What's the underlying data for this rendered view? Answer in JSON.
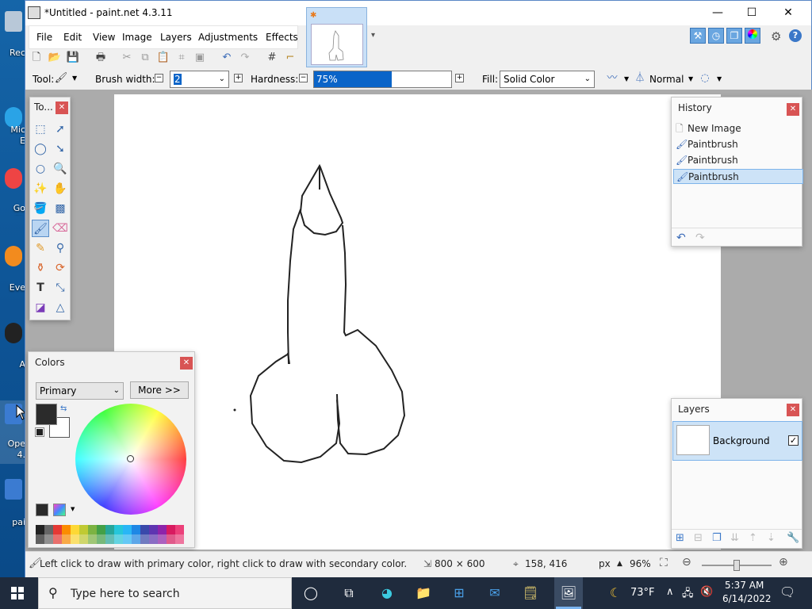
{
  "window": {
    "title": "*Untitled - paint.net 4.3.11",
    "minimize": "—",
    "maximize": "☐",
    "close": "✕"
  },
  "menu": [
    "File",
    "Edit",
    "View",
    "Image",
    "Layers",
    "Adjustments",
    "Effects"
  ],
  "toolbar": {
    "tool_label": "Tool:",
    "brush_width_label": "Brush width:",
    "brush_width_value": "2",
    "hardness_label": "Hardness:",
    "hardness_value": "75%",
    "hardness_fraction": 0.75,
    "fill_label": "Fill:",
    "fill_value": "Solid Color",
    "blend_mode": "Normal"
  },
  "tools_panel": {
    "title": "To..."
  },
  "colors_panel": {
    "title": "Colors",
    "mode": "Primary",
    "more_button": "More >>",
    "primary_color": "#2b2b2b",
    "secondary_color": "#ffffff",
    "palette": [
      "#222222",
      "#666666",
      "#e53935",
      "#fb8c00",
      "#fdd835",
      "#c0ca33",
      "#7cb342",
      "#43a047",
      "#26a69a",
      "#26c6da",
      "#29b6f6",
      "#1e88e5",
      "#3949ab",
      "#5e35b1",
      "#8e24aa",
      "#d81b60",
      "#ec407a"
    ]
  },
  "history_panel": {
    "title": "History",
    "items": [
      "New Image",
      "Paintbrush",
      "Paintbrush",
      "Paintbrush"
    ],
    "selected_index": 3
  },
  "layers_panel": {
    "title": "Layers",
    "layers": [
      {
        "name": "Background",
        "visible": true
      }
    ]
  },
  "statusbar": {
    "hint": "Left click to draw with primary color, right click to draw with secondary color.",
    "image_size": "800 × 600",
    "cursor_pos": "158, 416",
    "unit": "px",
    "zoom": "96%"
  },
  "taskbar": {
    "search_placeholder": "Type here to search",
    "weather": "73°F",
    "time": "5:37 AM",
    "date": "6/14/2022"
  },
  "desktop_icons": [
    "Rec",
    "Mic\nE",
    "Go\nCh",
    "Eve",
    "A",
    "Ope\n4.",
    "pai"
  ]
}
